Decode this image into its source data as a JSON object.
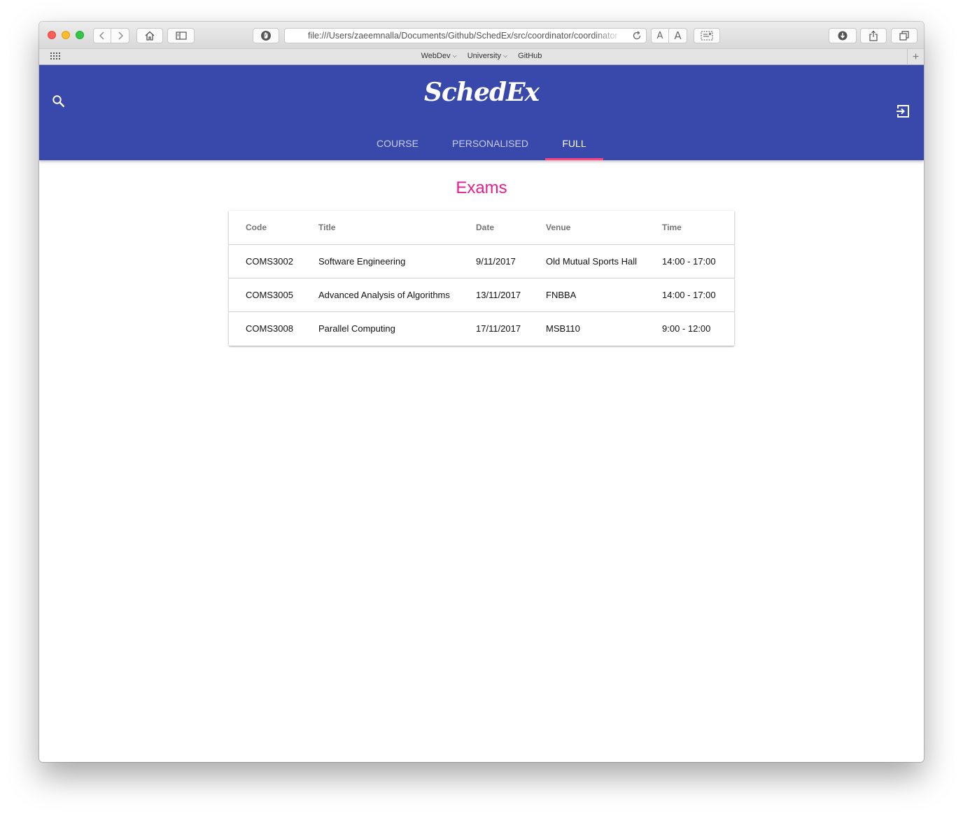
{
  "browser": {
    "url": "file:///Users/zaeemnalla/Documents/Github/SchedEx/src/coordinator/coordinator",
    "font_small_label": "A",
    "font_large_label": "A",
    "favorites": [
      {
        "label": "WebDev",
        "has_menu": true
      },
      {
        "label": "University",
        "has_menu": true
      },
      {
        "label": "GitHub",
        "has_menu": false
      }
    ],
    "add_label": "+"
  },
  "app": {
    "brand": "SchedEx",
    "tabs": [
      {
        "label": "COURSE",
        "active": false
      },
      {
        "label": "PERSONALISED",
        "active": false
      },
      {
        "label": "FULL",
        "active": true
      }
    ],
    "accent_color": "#ff4081",
    "header_color": "#3949ab"
  },
  "exams": {
    "title": "Exams",
    "columns": [
      "Code",
      "Title",
      "Date",
      "Venue",
      "Time"
    ],
    "rows": [
      [
        "COMS3002",
        "Software Engineering",
        "9/11/2017",
        "Old Mutual Sports Hall",
        "14:00 - 17:00"
      ],
      [
        "COMS3005",
        "Advanced Analysis of Algorithms",
        "13/11/2017",
        "FNBBA",
        "14:00 - 17:00"
      ],
      [
        "COMS3008",
        "Parallel Computing",
        "17/11/2017",
        "MSB110",
        "9:00 - 12:00"
      ]
    ]
  },
  "icons": {
    "search": "search-icon",
    "logout": "logout-icon",
    "back": "chevron-left-icon",
    "forward": "chevron-right-icon",
    "home": "home-icon",
    "sidebar": "sidebar-icon",
    "shield": "shield-icon",
    "reload": "reload-icon",
    "reader": "reader-icon",
    "download": "download-icon",
    "share": "share-icon",
    "tabs": "tabs-overview-icon",
    "grid": "grid-icon"
  }
}
